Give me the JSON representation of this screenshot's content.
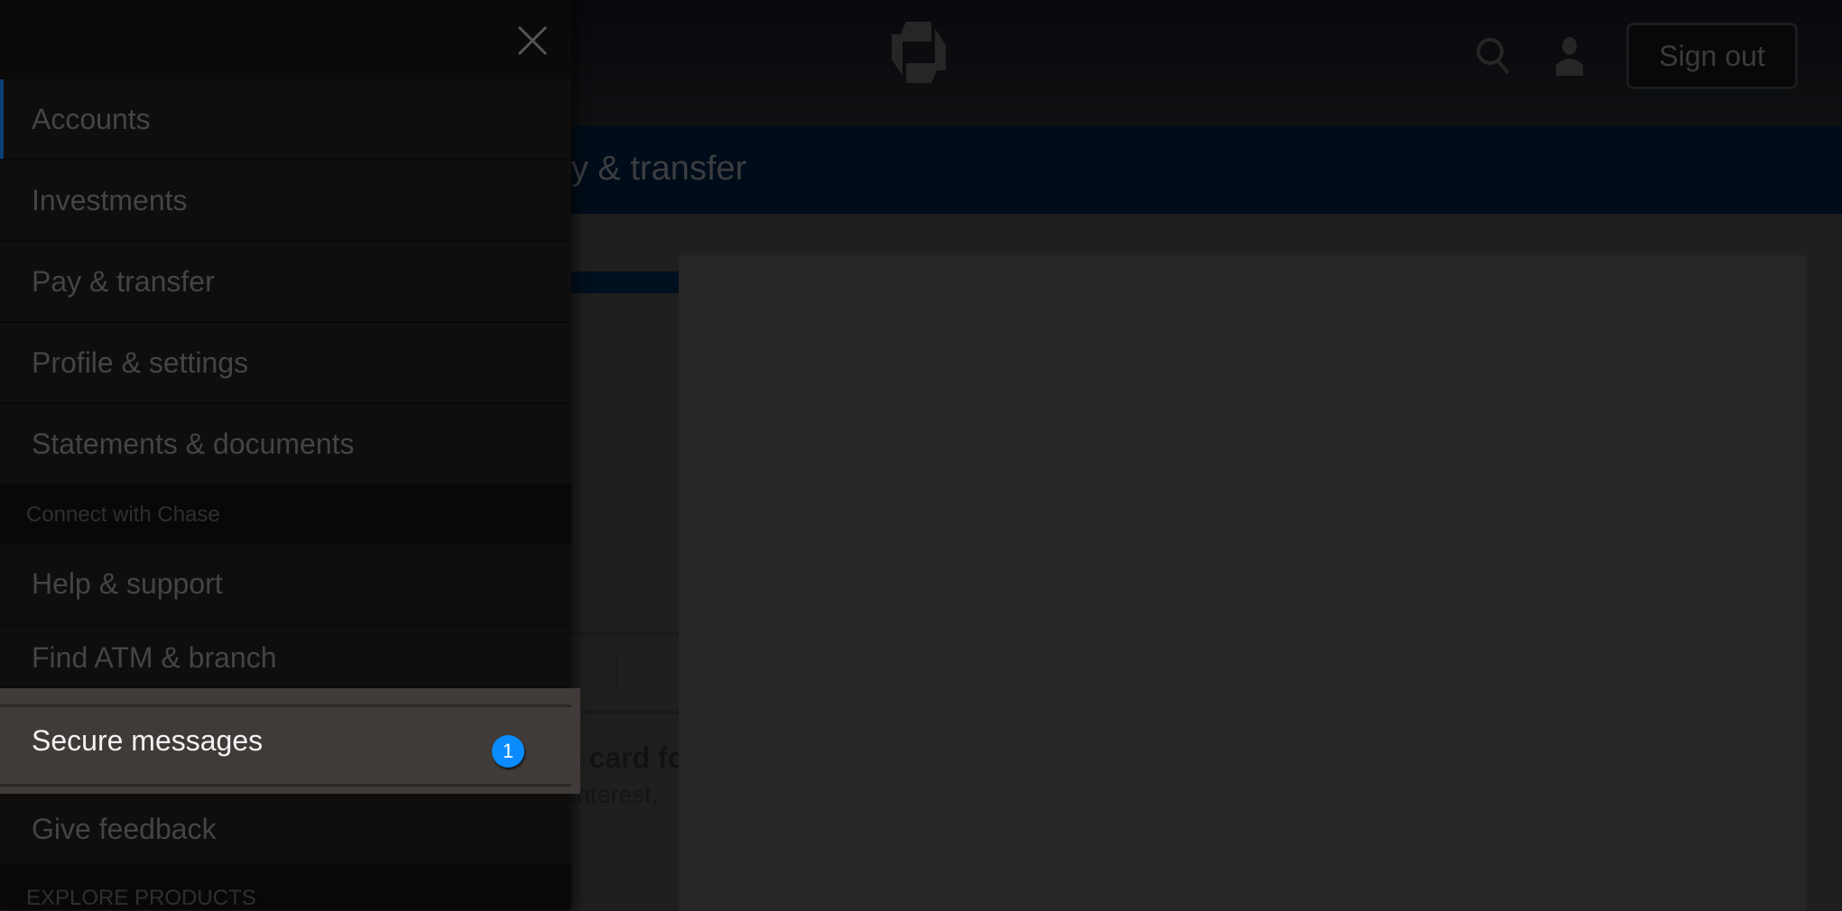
{
  "header": {
    "sign_out": "Sign out",
    "nav_title_partial": "y & transfer"
  },
  "promo": {
    "title_partial": "t card fo",
    "body_partial": "interest,"
  },
  "drawer": {
    "items": [
      {
        "label": "Accounts",
        "active": true
      },
      {
        "label": "Investments"
      },
      {
        "label": "Pay & transfer"
      },
      {
        "label": "Profile & settings"
      },
      {
        "label": "Statements & documents"
      }
    ],
    "connect_header": "Connect with Chase",
    "connect_items": [
      {
        "label": "Help & support"
      },
      {
        "label": "Find ATM & branch"
      }
    ],
    "secure_messages": {
      "label": "Secure messages",
      "badge": "1"
    },
    "give_feedback": "Give feedback",
    "explore_header": "EXPLORE PRODUCTS"
  },
  "colors": {
    "accent": "#0a8cff",
    "active_bar": "#0b3f73"
  }
}
